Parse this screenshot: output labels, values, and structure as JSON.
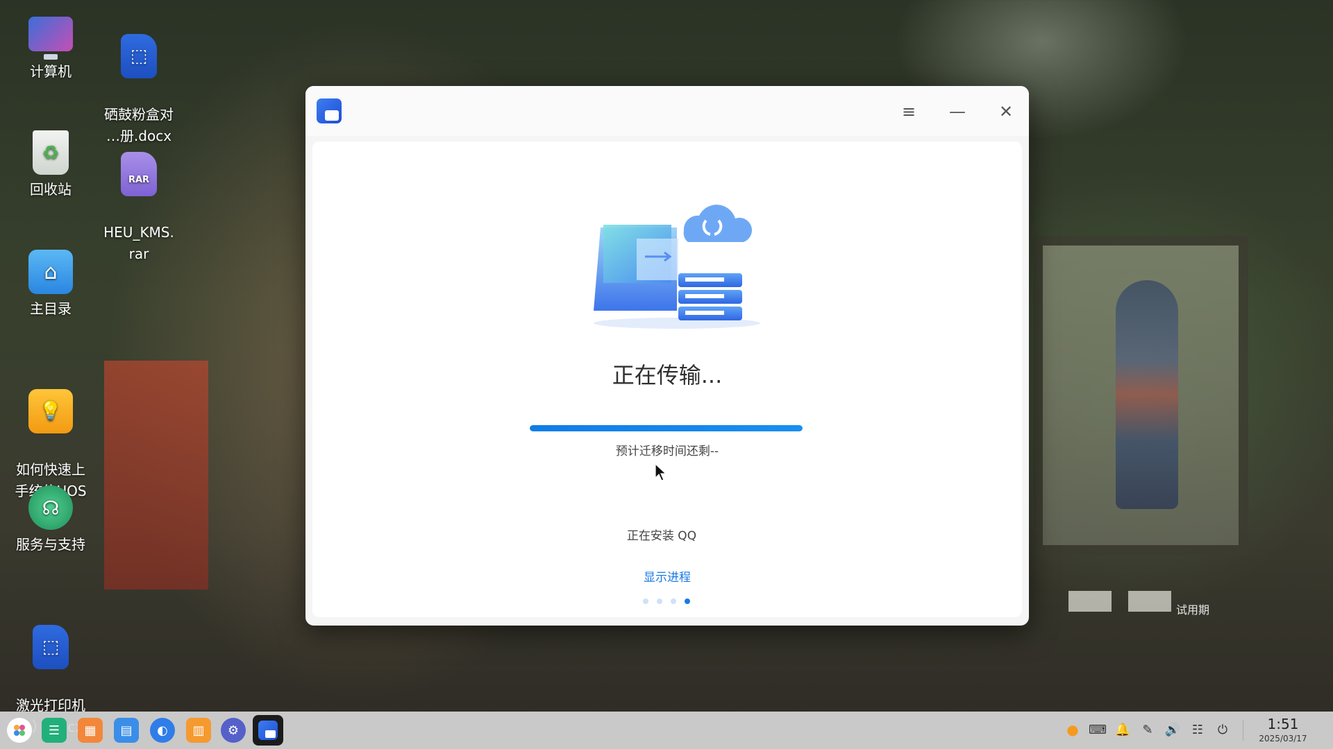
{
  "desktop": {
    "icons": [
      {
        "label": "计算机",
        "icon": "computer-icon"
      },
      {
        "label": "硒鼓粉盒对\n…册.docx",
        "icon": "word-doc-icon"
      },
      {
        "label": "回收站",
        "icon": "trash-icon"
      },
      {
        "label": "HEU_KMS.\nrar",
        "icon": "rar-archive-icon"
      },
      {
        "label": "主目录",
        "icon": "home-folder-icon"
      },
      {
        "label": "如何快速上\n手统信UOS",
        "icon": "lightbulb-icon"
      },
      {
        "label": "服务与支持",
        "icon": "support-headset-icon"
      },
      {
        "label": "激光打印机\n…）.docx",
        "icon": "word-doc-icon"
      }
    ],
    "rar_badge": "RAR",
    "uos_badge": "UOS",
    "trial_label": "试用期"
  },
  "window": {
    "title_icon": "transfer-app-icon",
    "controls": {
      "menu": "≡",
      "minimize": "—",
      "close": "✕"
    },
    "status_title": "正在传输...",
    "progress_percent": 100,
    "eta_text": "预计迁移时间还剩--",
    "install_text": "正在安装 QQ",
    "show_progress_link": "显示进程",
    "page_dots": {
      "count": 4,
      "active_index": 3
    }
  },
  "taskbar": {
    "apps": [
      "launcher-icon",
      "multitask-view-icon",
      "app-store-icon",
      "file-manager-icon",
      "browser-icon",
      "package-icon",
      "settings-icon",
      "data-transfer-icon"
    ],
    "tray": [
      "uos-ai-icon",
      "keyboard-icon",
      "notification-icon",
      "pen-icon",
      "volume-icon",
      "control-center-icon",
      "power-icon"
    ],
    "clock": {
      "time": "1:51",
      "date": "2025/03/17"
    }
  },
  "colors": {
    "accent": "#1a79e6",
    "progress": "#0f7de8",
    "window_bg": "#ffffff"
  }
}
